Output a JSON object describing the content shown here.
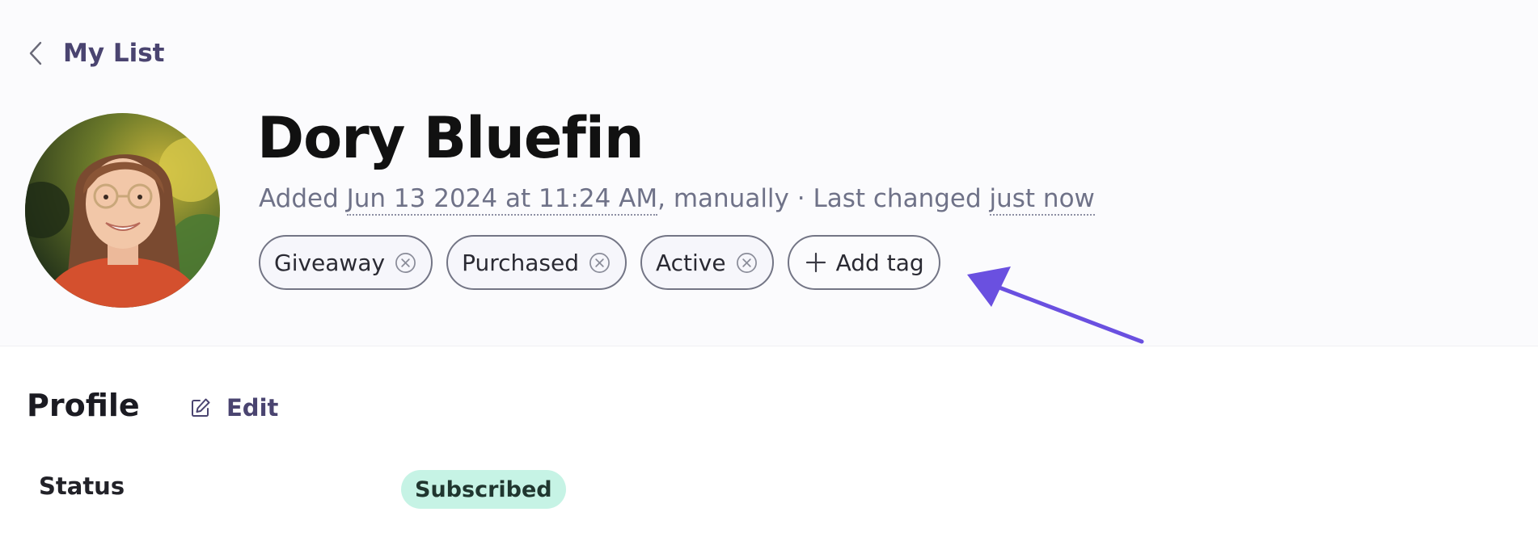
{
  "navigation": {
    "back_label": "My List"
  },
  "contact": {
    "name": "Dory Bluefin",
    "added_prefix": "Added ",
    "added_date": "Jun 13 2024 at 11:24 AM",
    "added_suffix": ", manually · Last changed ",
    "last_changed": "just now",
    "tags": [
      "Giveaway",
      "Purchased",
      "Active"
    ],
    "add_tag_label": "Add tag"
  },
  "profile": {
    "section_title": "Profile",
    "edit_label": "Edit",
    "status_label": "Status",
    "status_value": "Subscribed"
  },
  "colors": {
    "accent": "#4a4470",
    "annotation_arrow": "#6a50e0",
    "badge_bg": "#c6f3e5"
  }
}
